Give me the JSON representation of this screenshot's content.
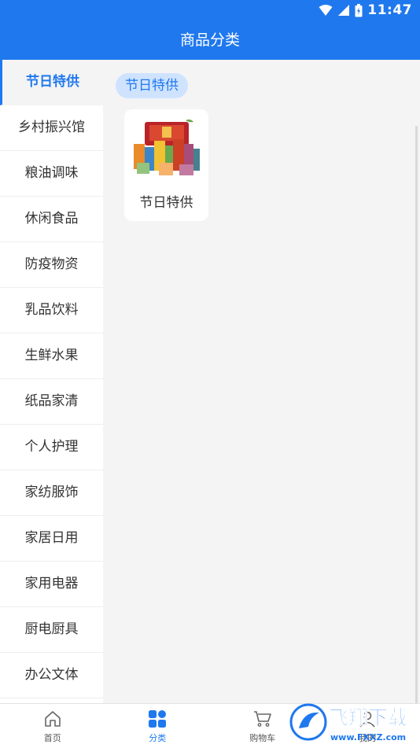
{
  "status": {
    "time": "11:47"
  },
  "header": {
    "title": "商品分类"
  },
  "sidebar": {
    "items": [
      {
        "label": "节日特供"
      },
      {
        "label": "乡村振兴馆"
      },
      {
        "label": "粮油调味"
      },
      {
        "label": "休闲食品"
      },
      {
        "label": "防疫物资"
      },
      {
        "label": "乳品饮料"
      },
      {
        "label": "生鲜水果"
      },
      {
        "label": "纸品家清"
      },
      {
        "label": "个人护理"
      },
      {
        "label": "家纺服饰"
      },
      {
        "label": "家居日用"
      },
      {
        "label": "家用电器"
      },
      {
        "label": "厨电厨具"
      },
      {
        "label": "办公文体"
      }
    ]
  },
  "main": {
    "section_label": "节日特供",
    "products": [
      {
        "name": "节日特供"
      }
    ]
  },
  "tabbar": {
    "items": [
      {
        "label": "首页",
        "icon": "home-icon"
      },
      {
        "label": "分类",
        "icon": "grid-icon"
      },
      {
        "label": "购物车",
        "icon": "cart-icon"
      },
      {
        "label": "我的",
        "icon": "user-icon"
      }
    ]
  },
  "watermark": {
    "text": "飞翔下载",
    "url_text": "www.FXXZ.com"
  },
  "colors": {
    "accent": "#1f78ee",
    "background": "#f4f4f4"
  }
}
